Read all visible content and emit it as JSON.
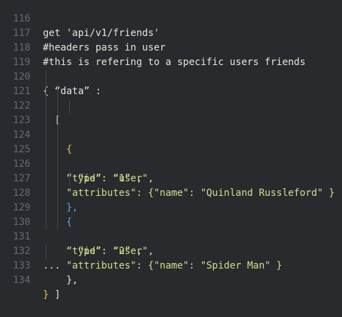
{
  "lines": [
    {
      "num": "116",
      "text": "get 'api/v1/friends'"
    },
    {
      "num": "117",
      "text": "#headers pass in user"
    },
    {
      "num": "118",
      "text": "#this is refering to a specific users friends"
    },
    {
      "num": "119",
      "text": ""
    },
    {
      "num": "120",
      "text": "{ “data” :"
    },
    {
      "num": "121",
      "text": "  ["
    },
    {
      "num": "122",
      "text": "    {"
    },
    {
      "num": "123",
      "text": "      “id”: “1” ,"
    },
    {
      "num": "124",
      "text": "    “type\": \"user\","
    },
    {
      "num": "125",
      "text": "    \"attributes\": {\"name\": \"Quinland Russleford\" }"
    },
    {
      "num": "126",
      "text": "    },"
    },
    {
      "num": "127",
      "text": "    {"
    },
    {
      "num": "128",
      "text": "      “id”: “2” ,"
    },
    {
      "num": "129",
      "text": "    “type\": \"user\","
    },
    {
      "num": "130",
      "text": "    \"attributes\": {\"name\": \"Spider Man\" }"
    },
    {
      "num": "131",
      "text": "    },"
    },
    {
      "num": "132",
      "text": "..."
    },
    {
      "num": "133",
      "text": "  ]"
    },
    {
      "num": "134",
      "text": "}"
    }
  ],
  "colors": {
    "background": "#282a2e",
    "gutter": "#666a70",
    "text": "#e6e6d8",
    "string": "#cfe08a",
    "number": "#e8685a",
    "brace": "#f0c040",
    "brace_blue": "#5aa6e8"
  }
}
